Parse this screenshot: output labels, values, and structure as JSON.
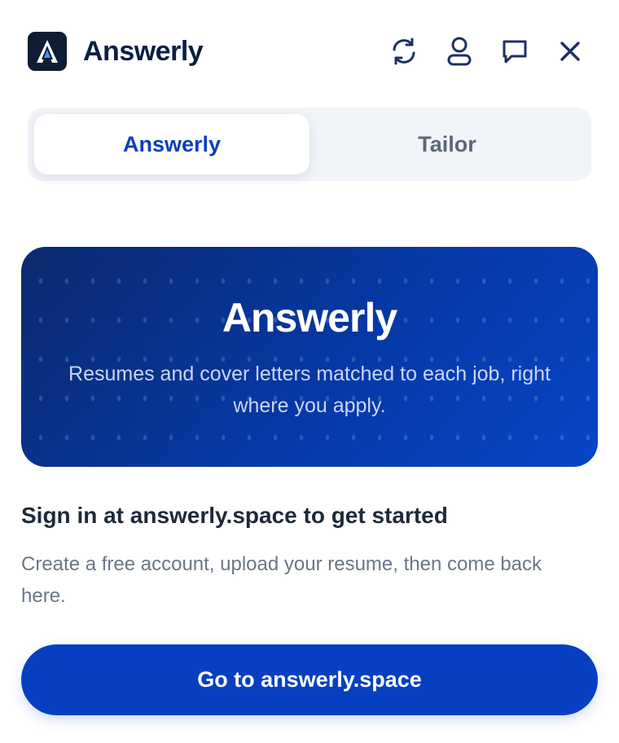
{
  "header": {
    "brand": "Answerly",
    "logo_icon": "answerly-a-logo-icon",
    "actions": [
      {
        "icon": "refresh-icon"
      },
      {
        "icon": "user-icon"
      },
      {
        "icon": "chat-icon"
      },
      {
        "icon": "close-icon"
      }
    ]
  },
  "tabs": [
    {
      "label": "Answerly",
      "active": true
    },
    {
      "label": "Tailor",
      "active": false
    }
  ],
  "hero": {
    "title": "Answerly",
    "subtitle": "Resumes and cover letters matched to each job, right where you apply."
  },
  "signin": {
    "title": "Sign in at answerly.space to get started",
    "body": "Create a free account, upload your resume, then come back here."
  },
  "cta": {
    "label": "Go to answerly.space"
  },
  "colors": {
    "accent": "#0640c1",
    "brand_text": "#0b1f44",
    "hero_start": "#0b2a6e",
    "hero_end": "#0646c9"
  }
}
